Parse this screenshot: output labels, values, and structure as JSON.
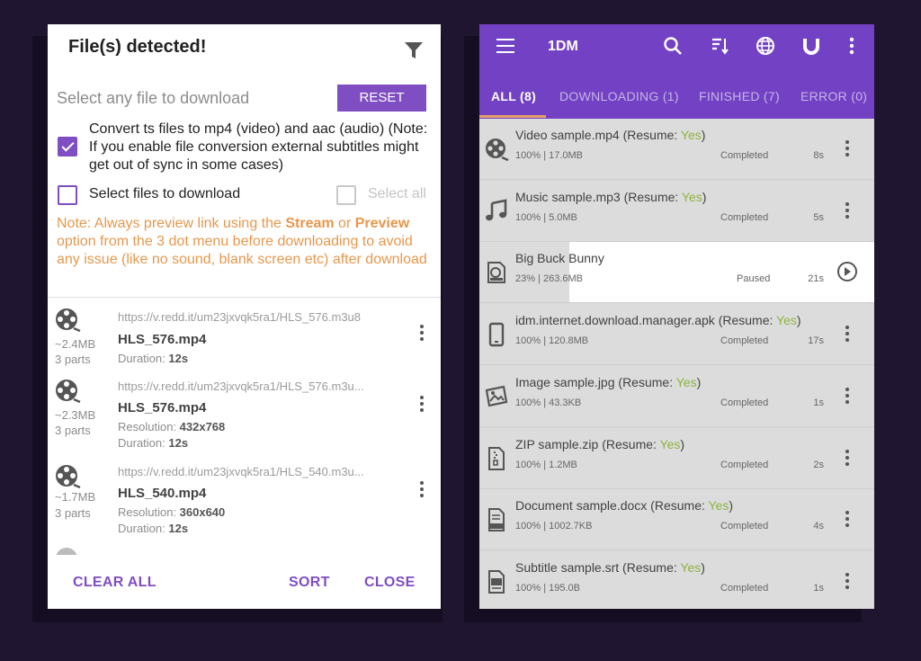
{
  "left": {
    "title": "File(s) detected!",
    "subtitle": "Select any file to download",
    "reset_label": "RESET",
    "convert_label": "Convert ts files to mp4 (video) and aac (audio) (Note: If you enable file conversion external subtitles might get out of sync in some cases)",
    "select_files_label": "Select files to download",
    "select_all_label": "Select all",
    "note_prefix": "Note: Always preview link using the ",
    "note_stream": "Stream",
    "note_or": " or ",
    "note_preview": "Preview",
    "note_suffix": " option from the 3 dot menu before downloading to avoid any issue (like no sound, blank screen etc) after download",
    "files": [
      {
        "size": "~2.4MB",
        "parts": "3 parts",
        "url": "https://v.redd.it/um23jxvqk5ra1/HLS_576.m3u8",
        "name": "HLS_576.mp4",
        "line1_label": "Duration: ",
        "line1_value": "12s",
        "line2_label": "",
        "line2_value": ""
      },
      {
        "size": "~2.3MB",
        "parts": "3 parts",
        "url": "https://v.redd.it/um23jxvqk5ra1/HLS_576.m3u...",
        "name": "HLS_576.mp4",
        "line1_label": "Resolution: ",
        "line1_value": "432x768",
        "line2_label": "Duration: ",
        "line2_value": "12s"
      },
      {
        "size": "~1.7MB",
        "parts": "3 parts",
        "url": "https://v.redd.it/um23jxvqk5ra1/HLS_540.m3u...",
        "name": "HLS_540.mp4",
        "line1_label": "Resolution: ",
        "line1_value": "360x640",
        "line2_label": "Duration: ",
        "line2_value": "12s"
      }
    ],
    "footer": {
      "clear_all": "CLEAR ALL",
      "sort": "SORT",
      "close": "CLOSE"
    }
  },
  "right": {
    "app_title": "1DM",
    "tabs": [
      "ALL (8)",
      "DOWNLOADING (1)",
      "FINISHED (7)",
      "ERROR (0)"
    ],
    "resume_label": " (Resume: ",
    "resume_yes": "Yes",
    "resume_close": ")",
    "downloads": [
      {
        "name": "Video sample.mp4",
        "resume": true,
        "sub": "100% | 17.0MB",
        "status": "Completed",
        "time": "8s",
        "icon": "film-reel-icon"
      },
      {
        "name": "Music sample.mp3",
        "resume": true,
        "sub": "100% | 5.0MB",
        "status": "Completed",
        "time": "5s",
        "icon": "music-note-icon"
      },
      {
        "name": "Big Buck Bunny",
        "resume": false,
        "sub": "23% | 263.6MB",
        "status": "Paused",
        "time": "21s",
        "icon": "web-video-icon"
      },
      {
        "name": "idm.internet.download.manager.apk",
        "resume": true,
        "sub": "100% | 120.8MB",
        "status": "Completed",
        "time": "17s",
        "icon": "phone-icon"
      },
      {
        "name": "Image sample.jpg",
        "resume": true,
        "sub": "100% | 43.3KB",
        "status": "Completed",
        "time": "1s",
        "icon": "image-icon"
      },
      {
        "name": "ZIP sample.zip",
        "resume": true,
        "sub": "100% | 1.2MB",
        "status": "Completed",
        "time": "2s",
        "icon": "zip-file-icon"
      },
      {
        "name": "Document sample.docx",
        "resume": true,
        "sub": "100% | 1002.7KB",
        "status": "Completed",
        "time": "4s",
        "icon": "doc-file-icon"
      },
      {
        "name": "Subtitle sample.srt",
        "resume": true,
        "sub": "100% | 195.0B",
        "status": "Completed",
        "time": "1s",
        "icon": "srt-file-icon"
      }
    ]
  }
}
